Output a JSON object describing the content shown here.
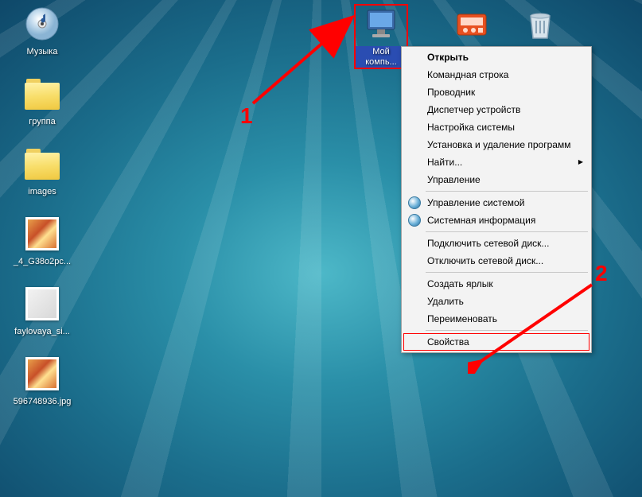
{
  "desktop_icons": {
    "music": {
      "label": "Музыка"
    },
    "group": {
      "label": "группа"
    },
    "images": {
      "label": "images"
    },
    "thumb1": {
      "label": "_4_G38o2pc..."
    },
    "thumb2": {
      "label": "faylovaya_si..."
    },
    "thumb3": {
      "label": "596748936.jpg"
    },
    "my_computer": {
      "label": "Мой компь..."
    },
    "panel": {
      "label": ""
    },
    "recycle": {
      "label": ""
    }
  },
  "context_menu": {
    "open": "Открыть",
    "cmd": "Командная строка",
    "explorer": "Проводник",
    "devmgr": "Диспетчер устройств",
    "msconfig": "Настройка системы",
    "appwiz": "Установка и удаление программ",
    "find": "Найти...",
    "manage": "Управление",
    "sysmanage": "Управление системой",
    "sysinfo": "Системная информация",
    "map_drive": "Подключить сетевой диск...",
    "unmap_drive": "Отключить сетевой диск...",
    "shortcut": "Создать ярлык",
    "delete": "Удалить",
    "rename": "Переименовать",
    "properties": "Свойства"
  },
  "annotations": {
    "one": "1",
    "two": "2"
  }
}
